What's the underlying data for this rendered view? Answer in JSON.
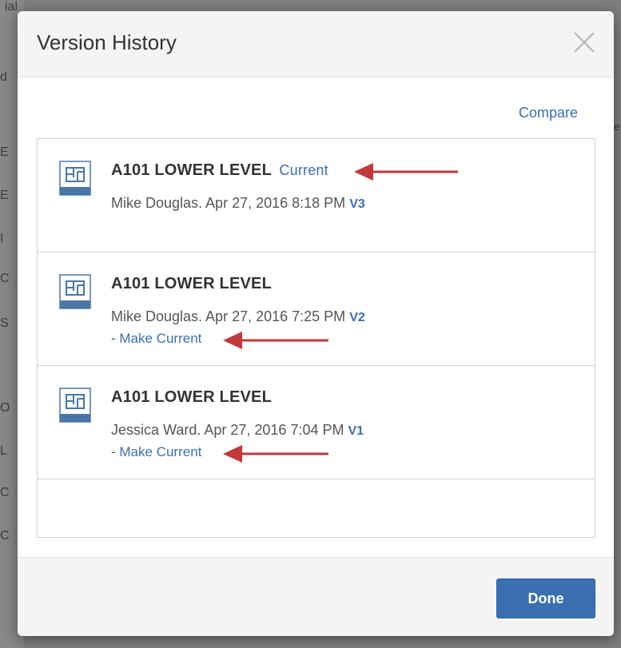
{
  "background": {
    "top_fragment": "ial",
    "left_fragments": [
      "d",
      "E",
      "E",
      "I",
      "C",
      "S",
      "O",
      "L",
      "C",
      "C"
    ],
    "right_fragment": "e"
  },
  "dialog": {
    "title": "Version History",
    "compare_label": "Compare",
    "done_label": "Done",
    "colors": {
      "accent": "#3a6fb0",
      "arrow": "#c0393b",
      "header_bg": "#f4f4f4"
    },
    "versions": [
      {
        "title": "A101 LOWER LEVEL",
        "current_label": "Current",
        "author_date": "Mike Douglas. Apr 27, 2016 8:18 PM",
        "version": "V3",
        "make_current_prefix": "",
        "make_current_label": ""
      },
      {
        "title": "A101 LOWER LEVEL",
        "current_label": "",
        "author_date": "Mike Douglas. Apr 27, 2016 7:25 PM",
        "version": "V2",
        "make_current_prefix": "- ",
        "make_current_label": "Make Current"
      },
      {
        "title": "A101 LOWER LEVEL",
        "current_label": "",
        "author_date": "Jessica Ward. Apr 27, 2016 7:04 PM",
        "version": "V1",
        "make_current_prefix": "- ",
        "make_current_label": "Make Current"
      }
    ]
  }
}
